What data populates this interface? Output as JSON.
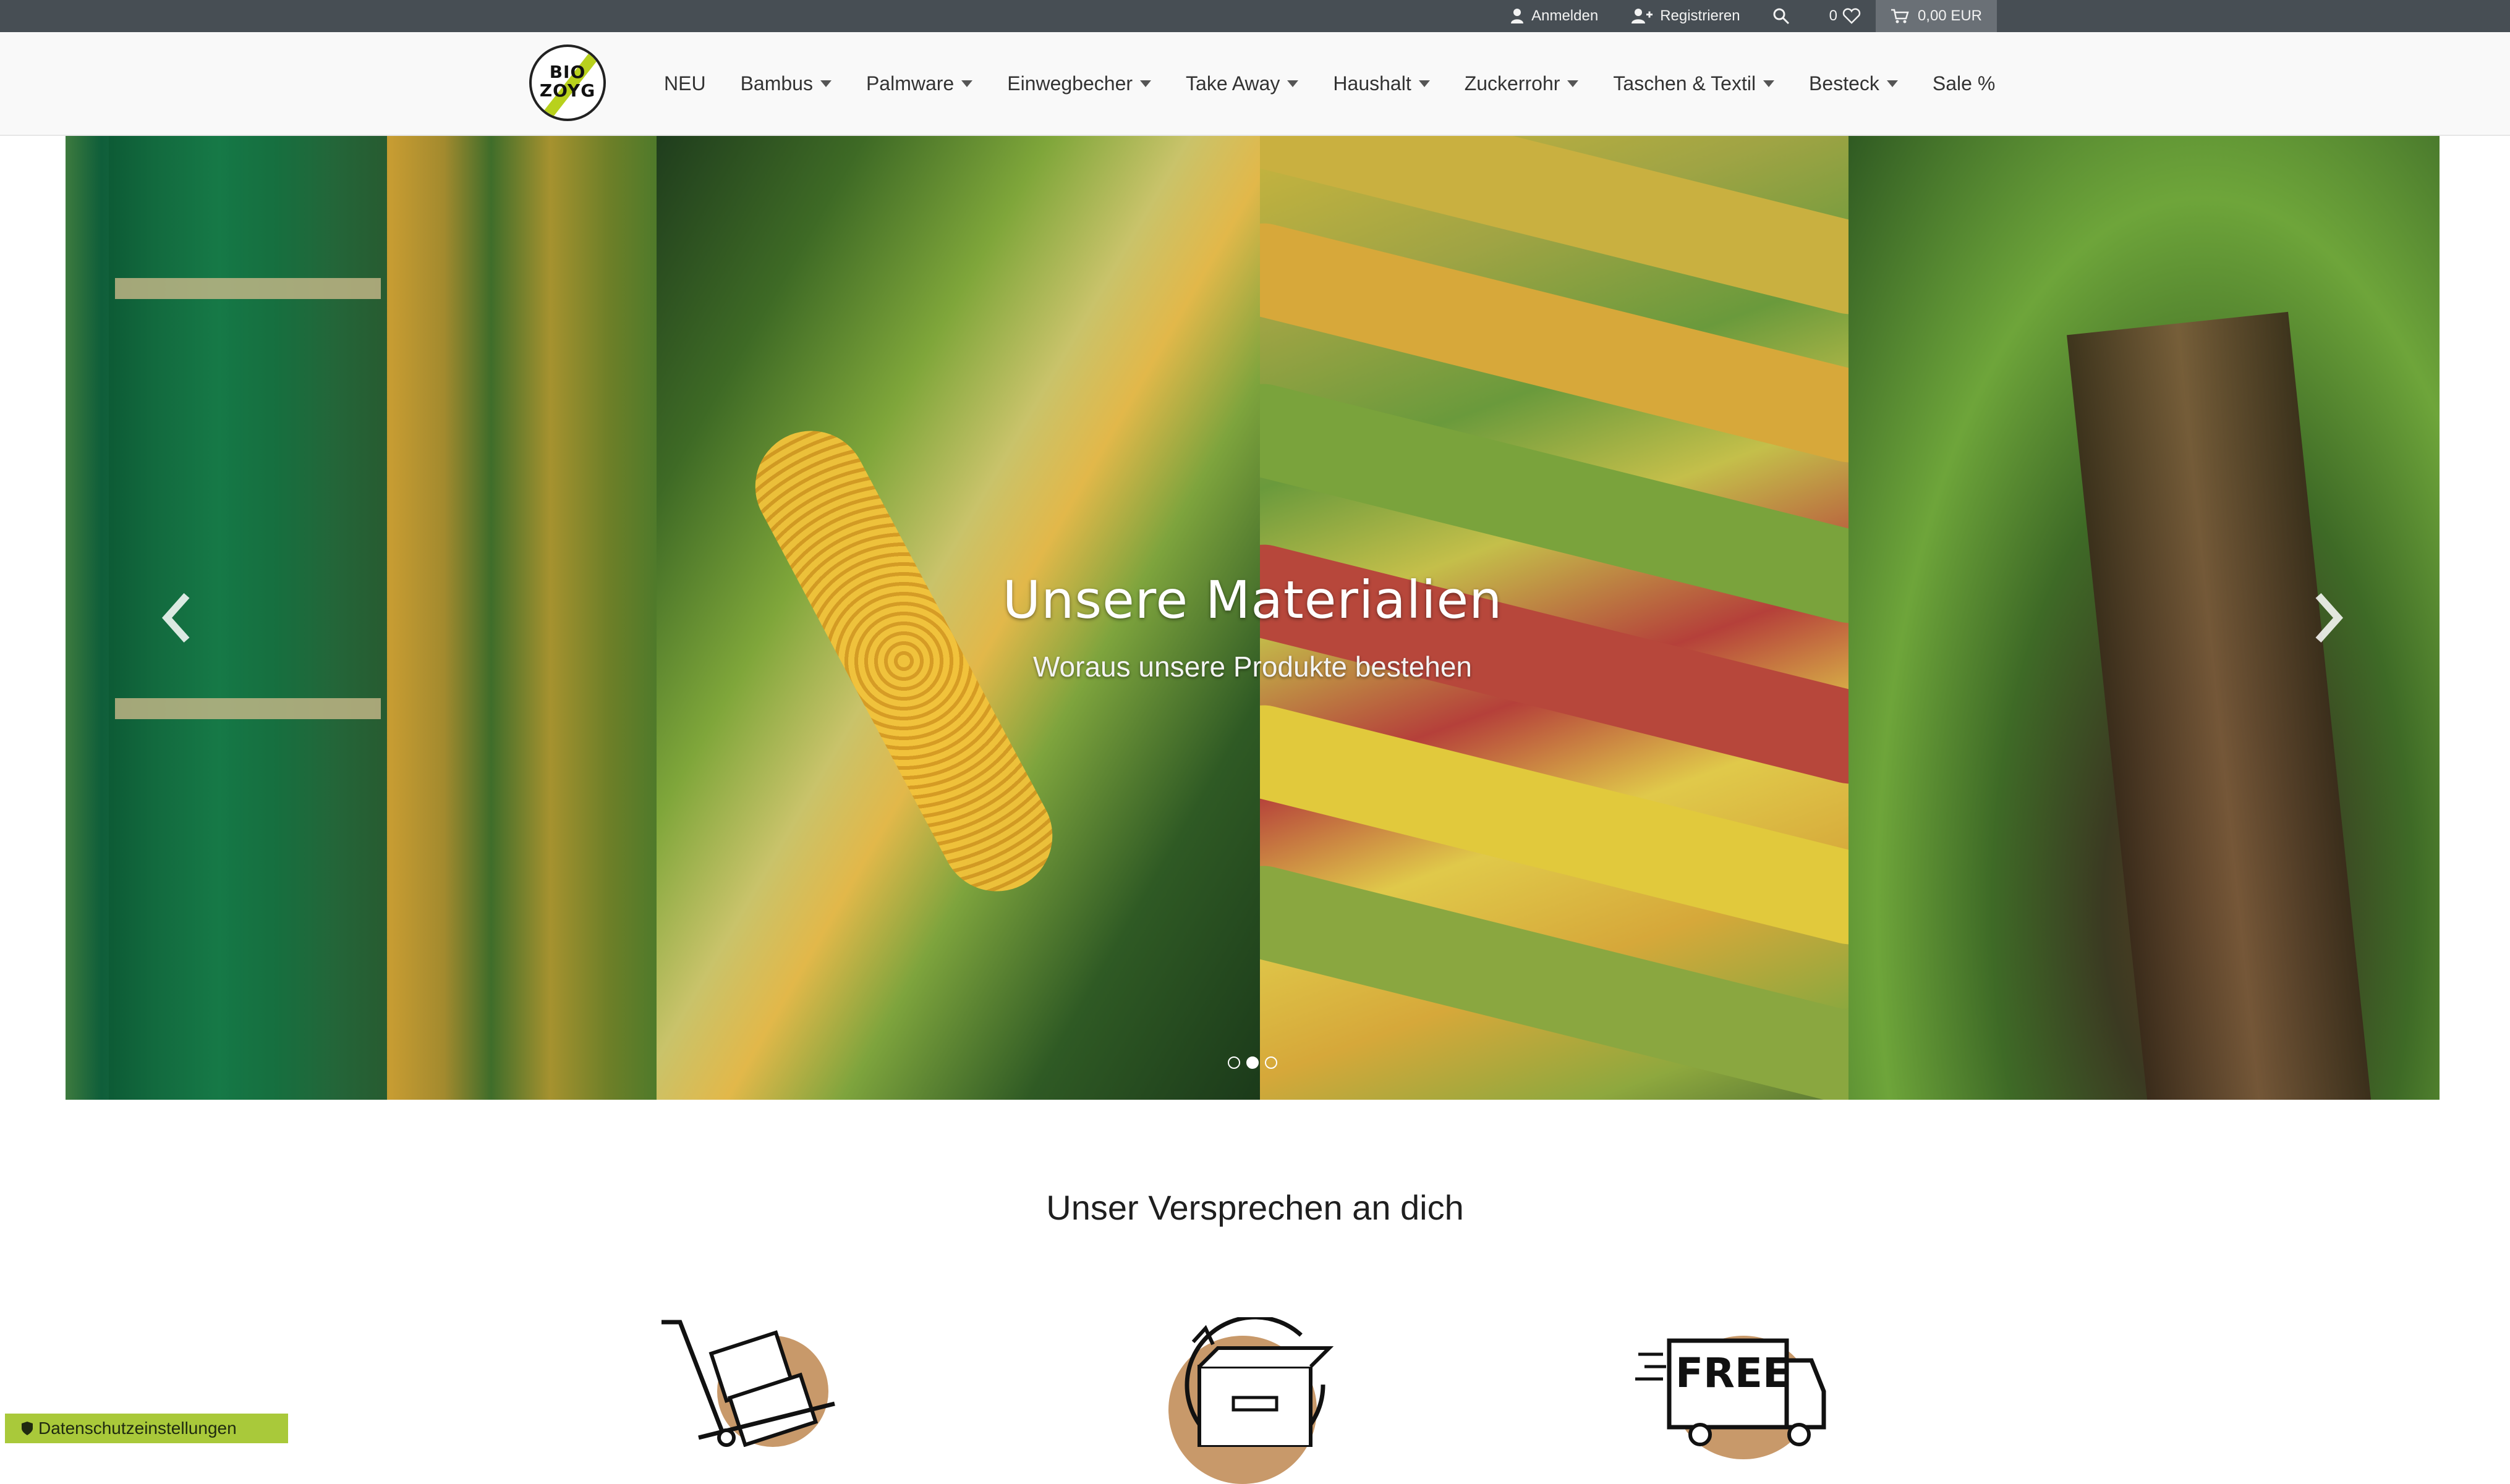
{
  "topbar": {
    "login_label": "Anmelden",
    "register_label": "Registrieren",
    "wishlist_count": "0",
    "cart_total": "0,00 EUR"
  },
  "logo": {
    "line1": "BIO",
    "line2": "ZOYG"
  },
  "menu": [
    {
      "label": "NEU",
      "dropdown": false
    },
    {
      "label": "Bambus",
      "dropdown": true
    },
    {
      "label": "Palmware",
      "dropdown": true
    },
    {
      "label": "Einwegbecher",
      "dropdown": true
    },
    {
      "label": "Take Away",
      "dropdown": true
    },
    {
      "label": "Haushalt",
      "dropdown": true
    },
    {
      "label": "Zuckerrohr",
      "dropdown": true
    },
    {
      "label": "Taschen & Textil",
      "dropdown": true
    },
    {
      "label": "Besteck",
      "dropdown": true
    },
    {
      "label": "Sale %",
      "dropdown": false
    }
  ],
  "hero": {
    "title": "Unsere Materialien",
    "subtitle": "Woraus unsere Produkte bestehen",
    "slide_count": 3,
    "active_slide": 2
  },
  "promise": {
    "title": "Unser Versprechen an dich"
  },
  "features": [
    {
      "icon": "hand-truck-box-icon"
    },
    {
      "icon": "return-box-icon"
    },
    {
      "icon": "free-delivery-truck-icon",
      "label": "FREE"
    }
  ],
  "privacy": {
    "label": "Datenschutzeinstellungen"
  },
  "colors": {
    "topbar": "#474e54",
    "accent_green": "#a9c93a",
    "icon_circle": "#c8996a"
  }
}
